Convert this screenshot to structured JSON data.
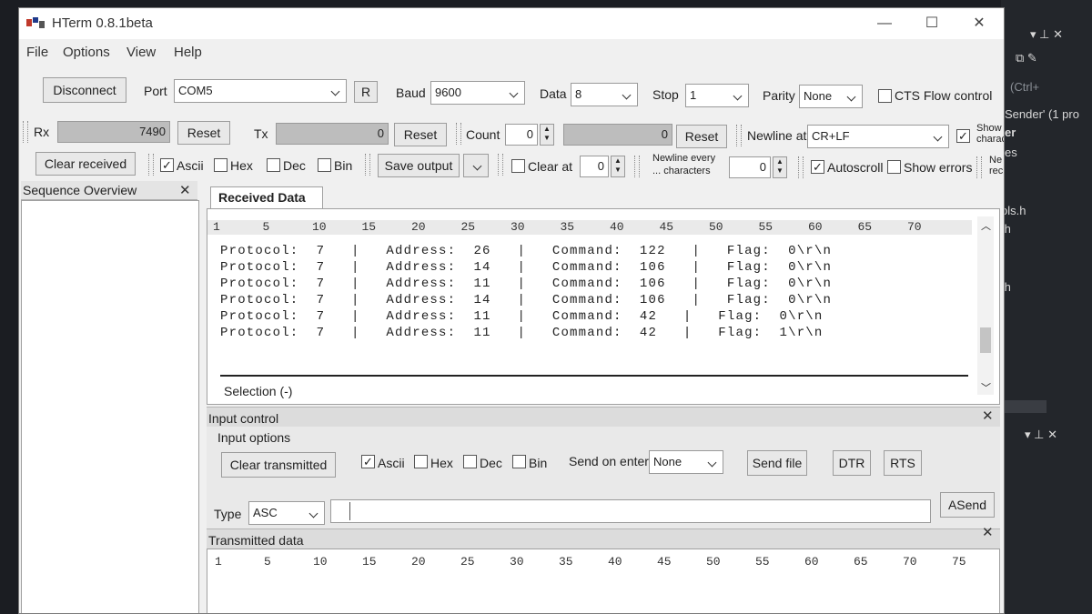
{
  "window": {
    "title": "HTerm 0.8.1beta"
  },
  "menu": [
    "File",
    "Options",
    "View",
    "Help"
  ],
  "connection": {
    "disconnect_label": "Disconnect",
    "port_label": "Port",
    "port_value": "COM5",
    "refresh_label": "R",
    "baud_label": "Baud",
    "baud_value": "9600",
    "data_label": "Data",
    "data_value": "8",
    "stop_label": "Stop",
    "stop_value": "1",
    "parity_label": "Parity",
    "parity_value": "None",
    "cts_label": "CTS Flow control",
    "cts_checked": false
  },
  "counters": {
    "rx_label": "Rx",
    "rx_value": "7490",
    "rx_reset": "Reset",
    "tx_label": "Tx",
    "tx_value": "0",
    "tx_reset": "Reset",
    "count_label": "Count",
    "count_value": "0",
    "count_box_value": "0",
    "count_reset": "Reset",
    "newline_label": "Newline at",
    "newline_value": "CR+LF",
    "show_chars_label": "Show characters",
    "show_chars_checked": true
  },
  "receive_options": {
    "clear_received": "Clear received",
    "ascii": "Ascii",
    "hex": "Hex",
    "dec": "Dec",
    "bin": "Bin",
    "save_output": "Save output",
    "clear_at": "Clear at",
    "clear_at_value": "0",
    "newline_every_line1": "Newline every",
    "newline_every_line2": "... characters",
    "newline_every_value": "0",
    "autoscroll": "Autoscroll",
    "show_errors": "Show errors",
    "new_recs": "Ne rec"
  },
  "sequence": {
    "title": "Sequence Overview"
  },
  "received": {
    "tab": "Received Data",
    "ruler": [
      "1",
      "5",
      "10",
      "15",
      "20",
      "25",
      "30",
      "35",
      "40",
      "45",
      "50",
      "55",
      "60",
      "65",
      "70"
    ],
    "lines": [
      "Protocol: 7 | Address: 26 | Command: 122 | Flag: 0\\r\\n",
      "Protocol: 7 | Address: 14 | Command: 106 | Flag: 0\\r\\n",
      "Protocol: 7 | Address: 11 | Command: 106 | Flag: 0\\r\\n",
      "Protocol: 7 | Address: 14 | Command: 106 | Flag: 0\\r\\n",
      "Protocol: 7 | Address: 11 | Command: 42 | Flag: 0\\r\\n",
      "Protocol: 7 | Address: 11 | Command: 42 | Flag: 1\\r\\n"
    ],
    "selection": "Selection (-)"
  },
  "input_control": {
    "title": "Input control",
    "options_title": "Input options",
    "clear_transmitted": "Clear transmitted",
    "ascii": "Ascii",
    "hex": "Hex",
    "dec": "Dec",
    "bin": "Bin",
    "send_on_enter_label": "Send on enter",
    "send_on_enter_value": "None",
    "send_file": "Send file",
    "dtr": "DTR",
    "rts": "RTS",
    "type_label": "Type",
    "type_value": "ASC",
    "asend": "ASend"
  },
  "transmitted": {
    "title": "Transmitted data",
    "ruler": [
      "1",
      "5",
      "10",
      "15",
      "20",
      "25",
      "30",
      "35",
      "40",
      "45",
      "50",
      "55",
      "60",
      "65",
      "70",
      "75"
    ]
  },
  "ide": {
    "lines": [
      "(Ctrl+",
      "Sender' (1 pro",
      "er",
      "es",
      "ols.h",
      ".h",
      ".h"
    ]
  }
}
